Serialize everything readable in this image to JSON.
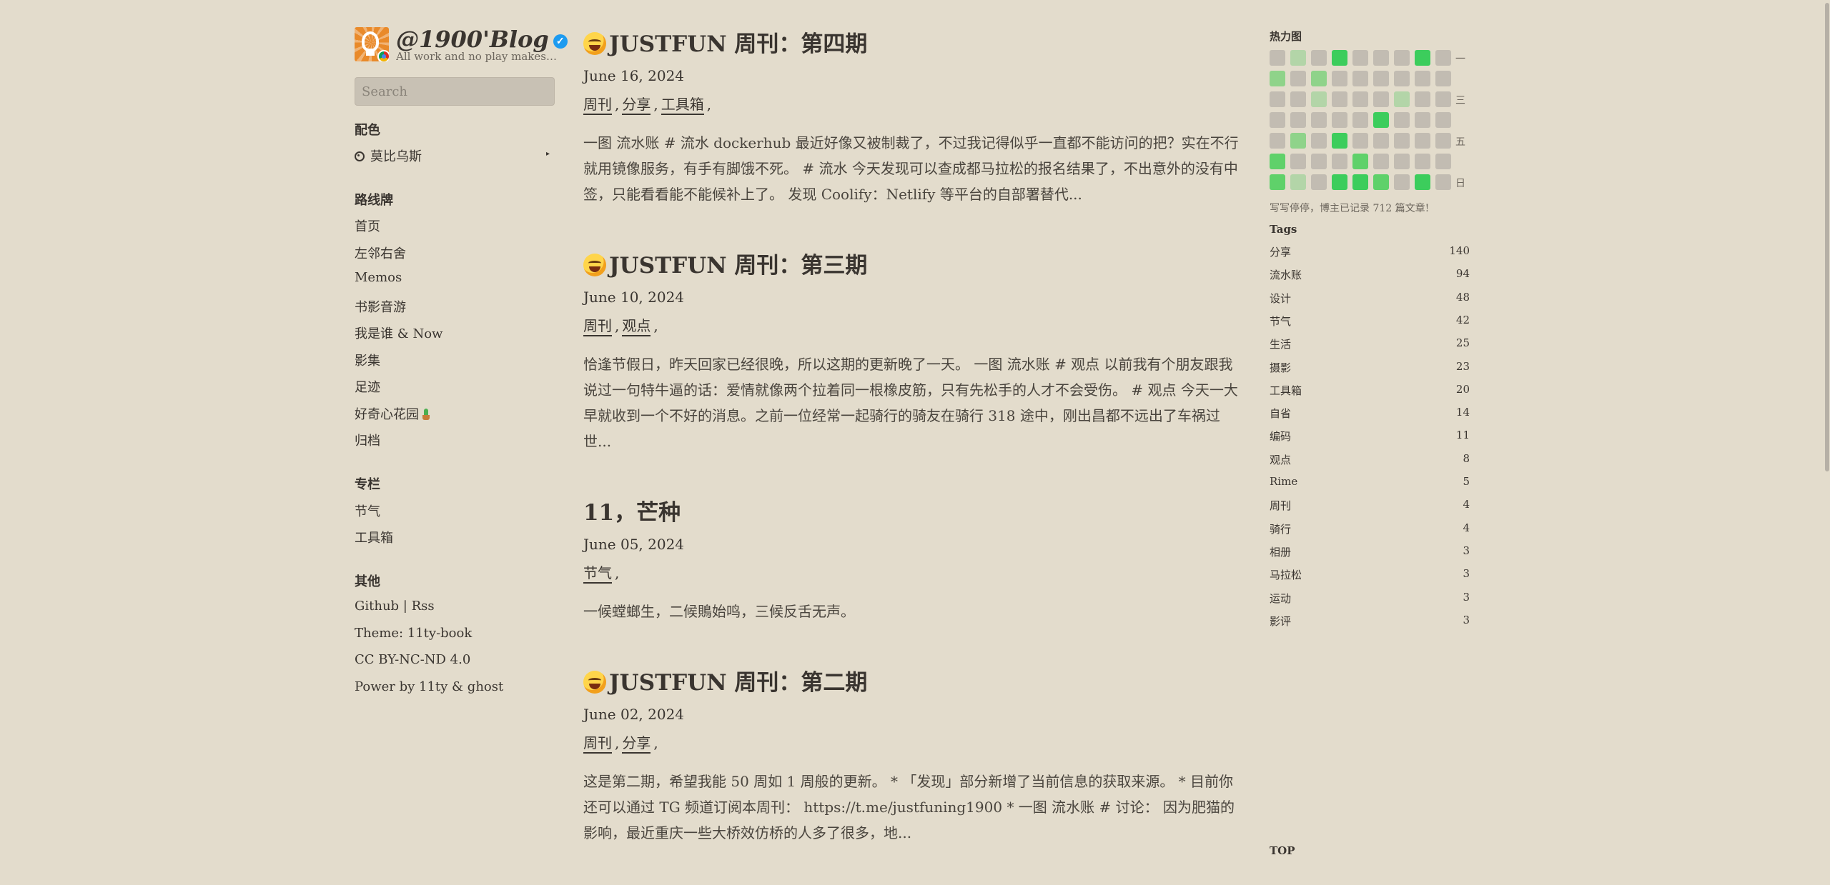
{
  "site": {
    "title": "@1900'Blog",
    "tagline": "All work and no play makes Jack a dull boy",
    "search_placeholder": "Search"
  },
  "sidebar": {
    "color_section": {
      "title": "配色",
      "value": "莫比乌斯"
    },
    "nav_section": {
      "title": "路线牌",
      "items": [
        "首页",
        "左邻右舍",
        "Memos",
        "书影音游",
        "我是谁 & Now",
        "影集",
        "足迹",
        "好奇心花园",
        "归档"
      ]
    },
    "column_section": {
      "title": "专栏",
      "items": [
        "节气",
        "工具箱"
      ]
    },
    "other_section": {
      "title": "其他",
      "items": [
        "Github | Rss",
        "Theme: 11ty-book",
        "CC BY-NC-ND 4.0",
        "Power by 11ty & ghost"
      ]
    }
  },
  "posts": [
    {
      "title": "JUSTFUN 周刊：第四期",
      "has_emoji": true,
      "date": "June 16, 2024",
      "tags": [
        "周刊",
        "分享",
        "工具箱"
      ],
      "excerpt": "一图 流水账 # 流水 dockerhub 最近好像又被制裁了，不过我记得似乎一直都不能访问的把？实在不行就用镜像服务，有手有脚饿不死。 # 流水 今天发现可以查成都马拉松的报名结果了，不出意外的没有中签，只能看看能不能候补上了。 发现 Coolify：Netlify 等平台的自部署替代..."
    },
    {
      "title": "JUSTFUN 周刊：第三期",
      "has_emoji": true,
      "date": "June 10, 2024",
      "tags": [
        "周刊",
        "观点"
      ],
      "excerpt": "恰逢节假日，昨天回家已经很晚，所以这期的更新晚了一天。 一图 流水账 # 观点 以前我有个朋友跟我说过一句特牛逼的话：爱情就像两个拉着同一根橡皮筋，只有先松手的人才不会受伤。 # 观点 今天一大早就收到一个不好的消息。之前一位经常一起骑行的骑友在骑行 318 途中，刚出昌都不远出了车祸过世..."
    },
    {
      "title": "11，芒种",
      "has_emoji": false,
      "date": "June 05, 2024",
      "tags": [
        "节气"
      ],
      "excerpt": "一候螳螂生，二候鵙始鸣，三候反舌无声。"
    },
    {
      "title": "JUSTFUN 周刊：第二期",
      "has_emoji": true,
      "date": "June 02, 2024",
      "tags": [
        "周刊",
        "分享"
      ],
      "excerpt": "这是第二期，希望我能 50 周如 1 周般的更新。 * 「发现」部分新增了当前信息的获取来源。 * 目前你还可以通过 TG 频道订阅本周刊： https://t.me/justfuning1900 * 一图 流水账 # 讨论： 因为肥猫的影响，最近重庆一些大桥效仿桥的人多了很多，地..."
    }
  ],
  "heatmap": {
    "title": "热力图",
    "day_labels": [
      "一",
      "三",
      "五",
      "日"
    ],
    "rows": [
      [
        0,
        1,
        0,
        4,
        0,
        0,
        0,
        4,
        0
      ],
      [
        2,
        0,
        2,
        0,
        0,
        0,
        0,
        0,
        0
      ],
      [
        0,
        0,
        1,
        0,
        0,
        0,
        1,
        0,
        0
      ],
      [
        0,
        0,
        0,
        0,
        0,
        4,
        0,
        0,
        0
      ],
      [
        0,
        2,
        0,
        4,
        0,
        0,
        0,
        0,
        0
      ],
      [
        3,
        0,
        0,
        0,
        3,
        0,
        0,
        0,
        0
      ],
      [
        3,
        1,
        0,
        4,
        4,
        3,
        0,
        4,
        0
      ]
    ],
    "note": "写写停停，博主已记录 712 篇文章!",
    "colors": {
      "empty": "#c2bcb2",
      "l1": "#b3d5a8",
      "l2": "#8fd38a",
      "l3": "#5fd16a",
      "l4": "#3ccd5c"
    }
  },
  "tags_panel": {
    "title": "Tags",
    "items": [
      {
        "name": "分享",
        "count": "140"
      },
      {
        "name": "流水账",
        "count": "94"
      },
      {
        "name": "设计",
        "count": "48"
      },
      {
        "name": "节气",
        "count": "42"
      },
      {
        "name": "生活",
        "count": "25"
      },
      {
        "name": "摄影",
        "count": "23"
      },
      {
        "name": "工具箱",
        "count": "20"
      },
      {
        "name": "自省",
        "count": "14"
      },
      {
        "name": "编码",
        "count": "11"
      },
      {
        "name": "观点",
        "count": "8"
      },
      {
        "name": "Rime",
        "count": "5"
      },
      {
        "name": "周刊",
        "count": "4"
      },
      {
        "name": "骑行",
        "count": "4"
      },
      {
        "name": "相册",
        "count": "3"
      },
      {
        "name": "马拉松",
        "count": "3"
      },
      {
        "name": "运动",
        "count": "3"
      },
      {
        "name": "影评",
        "count": "3"
      }
    ]
  },
  "top_label": "TOP"
}
